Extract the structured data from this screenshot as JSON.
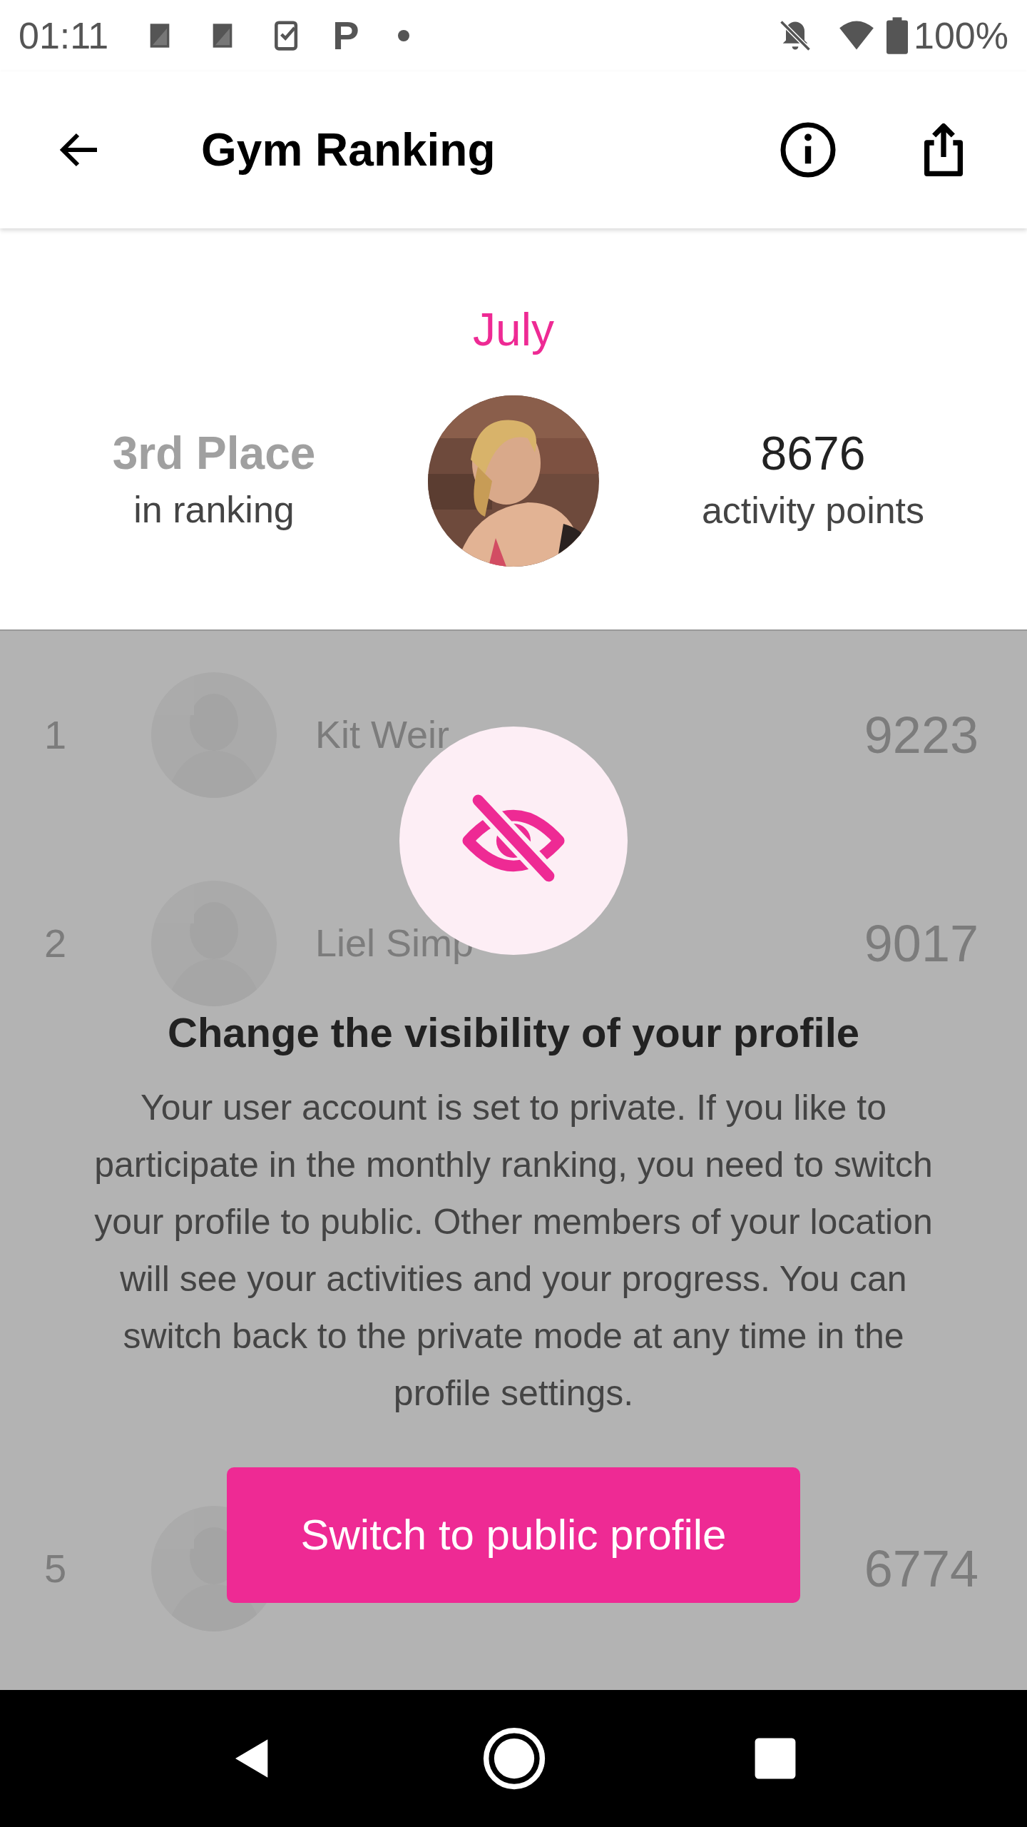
{
  "status_bar": {
    "time": "01:11",
    "app_letter": "P",
    "battery": "100%"
  },
  "app_bar": {
    "title": "Gym Ranking"
  },
  "summary": {
    "month": "July",
    "place": "3rd Place",
    "place_label": "in ranking",
    "points": "8676",
    "points_label": "activity points"
  },
  "ranking": [
    {
      "rank": "1",
      "name": "Kit Weir",
      "points": "9223"
    },
    {
      "rank": "2",
      "name": "Liel Simp",
      "points": "9017"
    },
    {
      "covered": true
    },
    {
      "covered": true
    },
    {
      "rank": "5",
      "points": "6774"
    }
  ],
  "dialog": {
    "title": "Change the visibility of your profile",
    "message": "Your user account is set to private. If you like to participate in the monthly ranking, you need to switch your profile to public. Other members of your location will see your activities and your progress. You can switch back to the private mode at any time in the profile settings.",
    "button": "Switch to public profile"
  }
}
